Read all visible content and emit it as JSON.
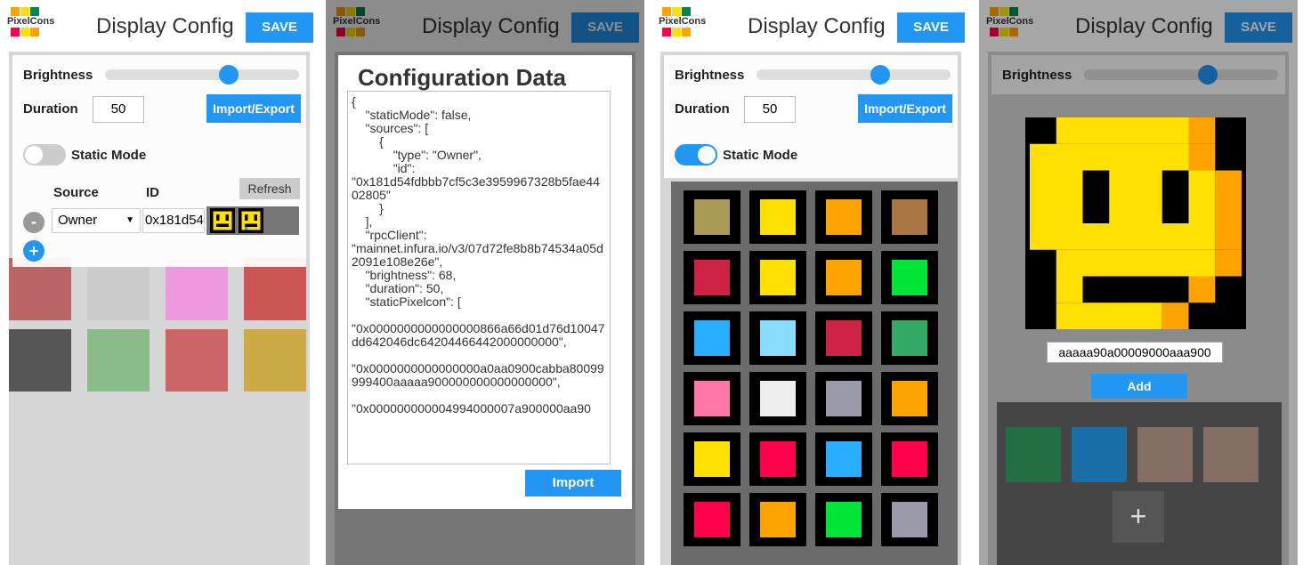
{
  "app": {
    "logo_text": "PixelCons",
    "title": "Display Config",
    "save_label": "SAVE"
  },
  "controls": {
    "brightness_label": "Brightness",
    "duration_label": "Duration",
    "duration_value": "50",
    "import_export_label": "Import/Export",
    "static_mode_label": "Static Mode",
    "brightness_value": 68
  },
  "sources": {
    "source_header": "Source",
    "id_header": "ID",
    "refresh_label": "Refresh",
    "source_value": "Owner",
    "id_value": "0x181d54",
    "remove_label": "-",
    "add_label": "+"
  },
  "modal": {
    "title": "Configuration Data",
    "json_text": "{\n    \"staticMode\": false,\n    \"sources\": [\n        {\n            \"type\": \"Owner\",\n            \"id\":\n\"0x181d54fdbbb7cf5c3e3959967328b5fae4402805\"\n        }\n    ],\n    \"rpcClient\":\n\"mainnet.infura.io/v3/07d72fe8b8b74534a05d2091e108e26e\",\n    \"brightness\": 68,\n    \"duration\": 50,\n    \"staticPixelcon\": [\n\n\"0x0000000000000000866a66d01d76d10047dd642046dc64204466442000000000\",\n\n\"0x0000000000000000a0aa0900cabba80099999400aaaaa900000000000000000\",\n\n\"0x000000000004994000007a900000aa90",
    "import_label": "Import"
  },
  "editor": {
    "hex_value": "aaaaa90a00009000aaa900",
    "add_label": "Add",
    "add_tile_label": "+"
  },
  "colors": {
    "accent": "#2196f3",
    "yellow": "#ffe000",
    "orange": "#ffa300"
  }
}
